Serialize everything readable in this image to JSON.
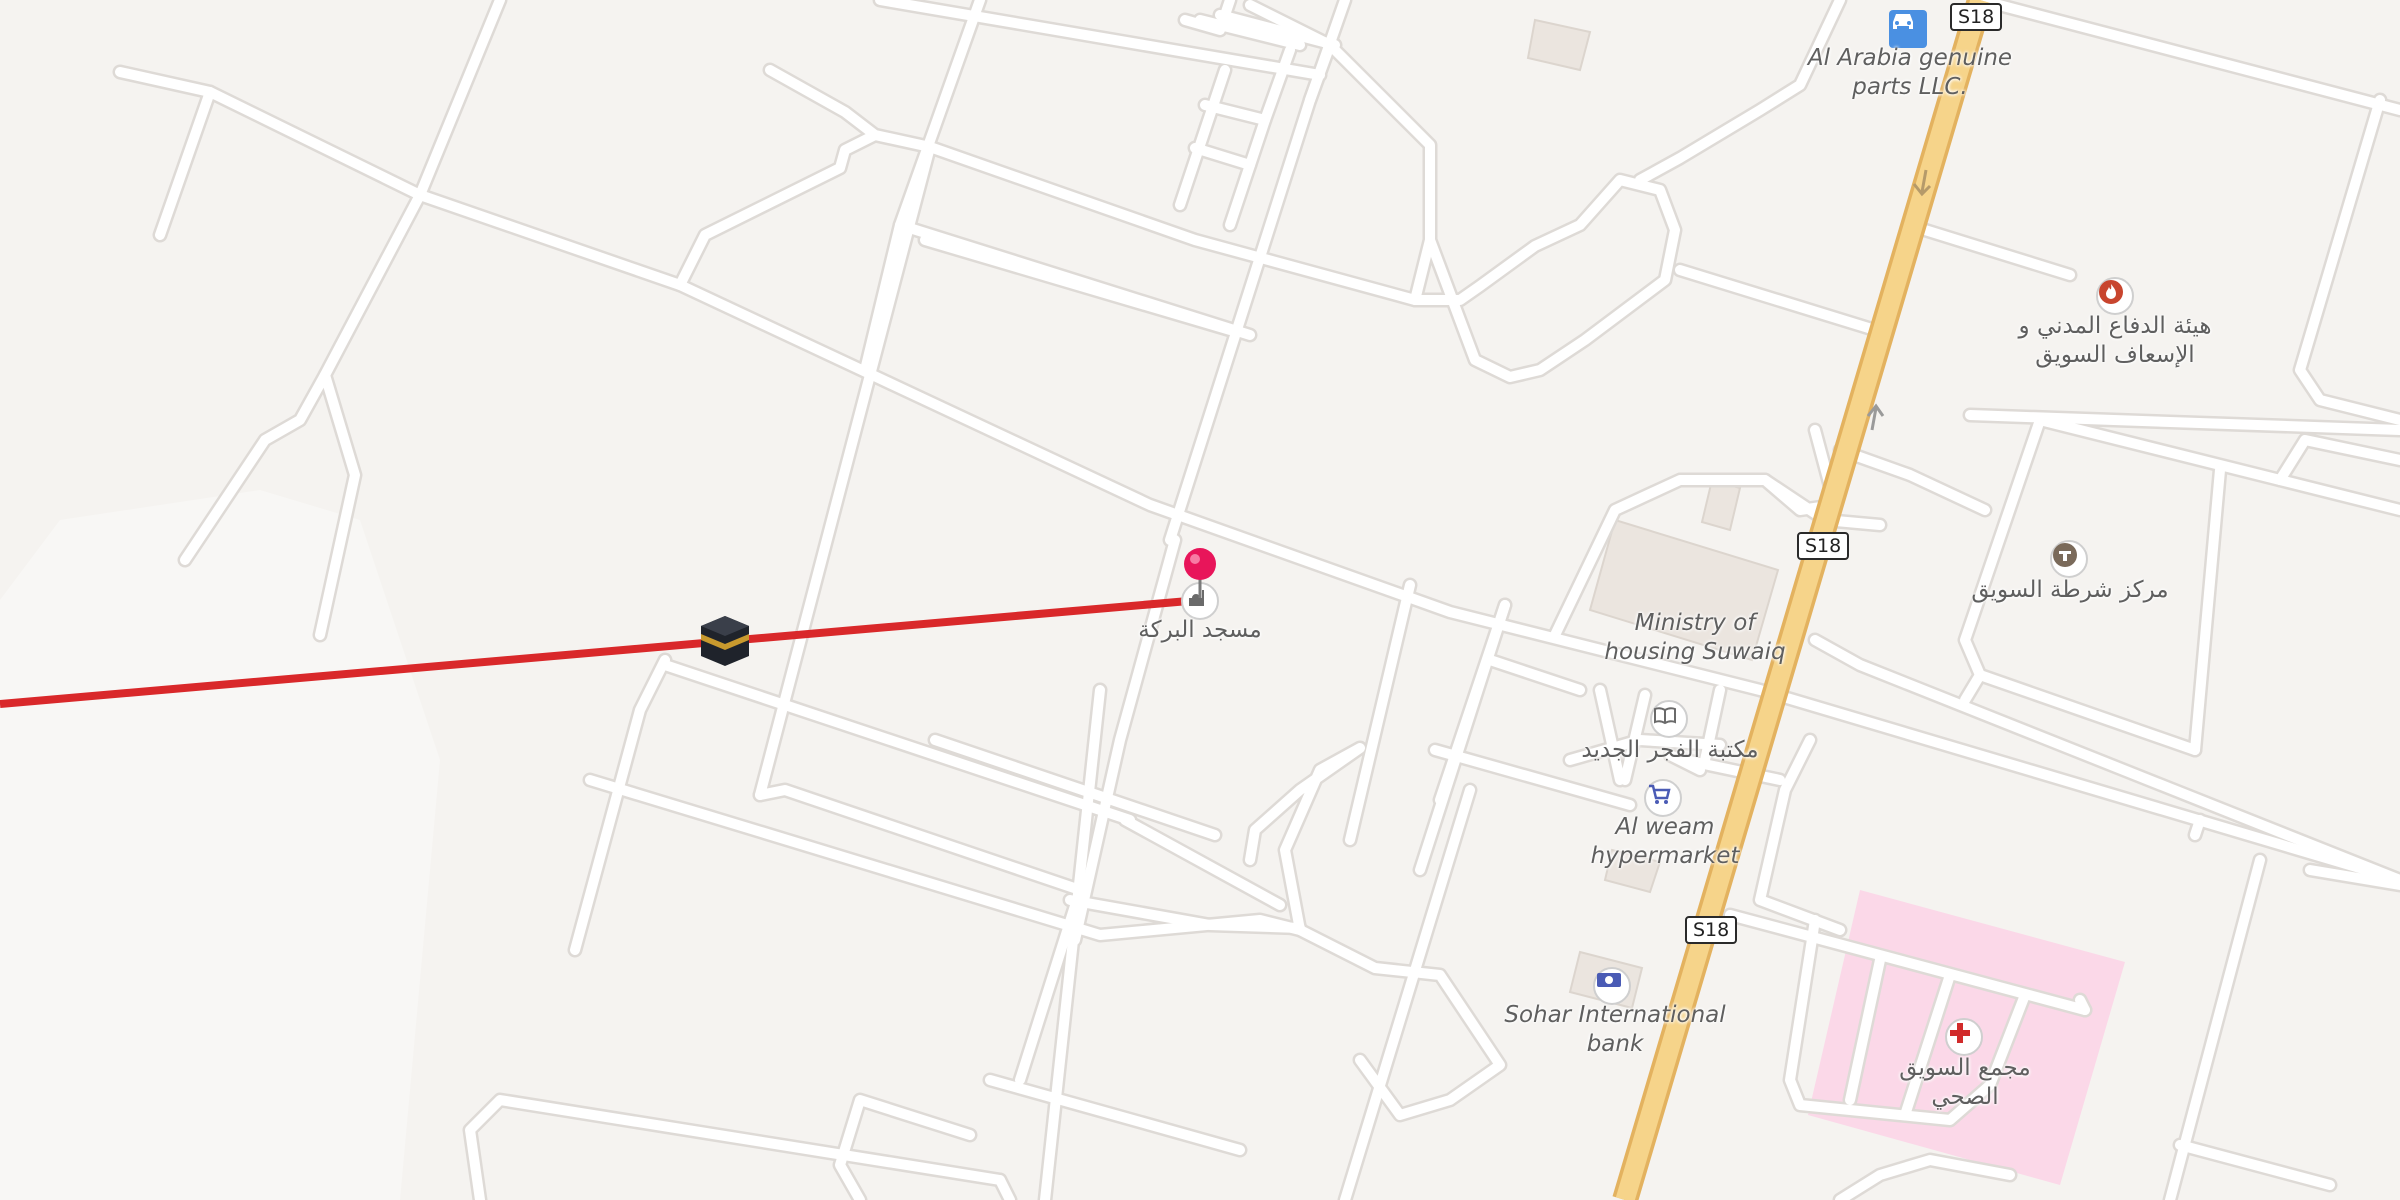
{
  "colors": {
    "background": "#f5f3f0",
    "road": "#ffffff",
    "road_casing": "#dedad6",
    "highway": "#f6d48a",
    "highway_casing": "#e3b25f",
    "route_line": "#d9282a",
    "hospital_area": "#fbd8e8",
    "pin": "#e8155a"
  },
  "route_shields": [
    "S18",
    "S18",
    "S18"
  ],
  "places": {
    "al_arabia": "Al Arabia genuine parts LLC.",
    "civil_defence": "هيئة الدفاع المدني و الإسعاف السويق",
    "police": "مركز شرطة السويق",
    "ministry": "Ministry of housing Suwaiq",
    "mosque": "مسجد البركة",
    "library": "مكتبة الفجر الجديد",
    "hypermarket": "Al weam hypermarket",
    "bank": "Sohar International bank",
    "health_complex": "مجمع السويق الصحي"
  },
  "icons": {
    "dealer": "car-icon",
    "fire": "fire-station-icon",
    "police": "police-icon",
    "mosque": "mosque-icon",
    "library": "book-icon",
    "market": "shopping-cart-icon",
    "bank": "banknote-icon",
    "hospital": "hospital-cross-icon",
    "qibla": "kaaba-icon",
    "location": "location-pin-icon"
  }
}
